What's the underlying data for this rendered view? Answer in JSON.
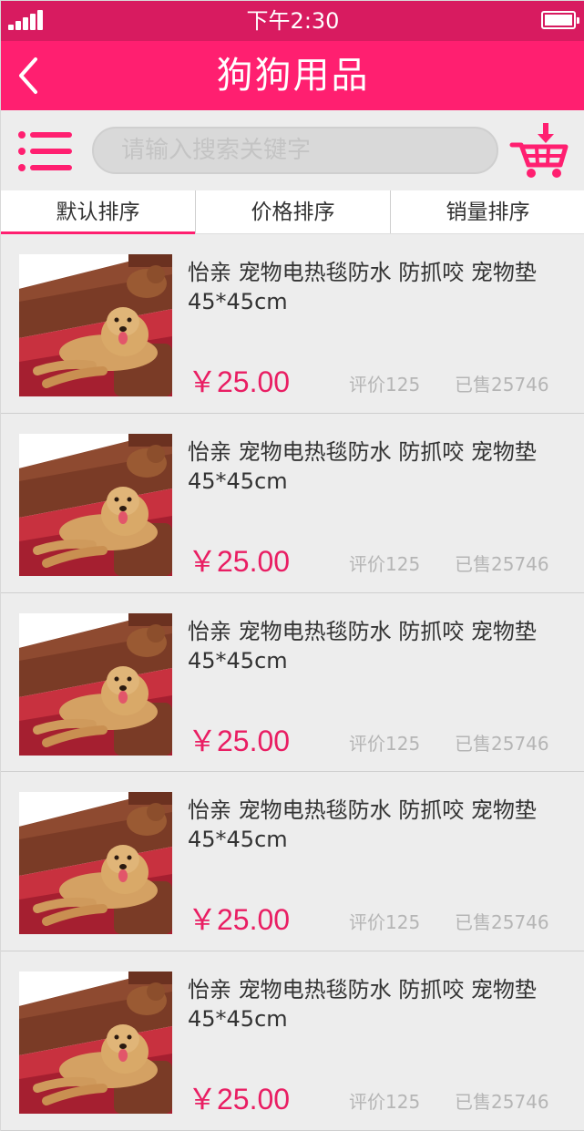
{
  "status_bar": {
    "time": "下午2:30"
  },
  "header": {
    "title": "狗狗用品",
    "back_icon": "chevron-left-icon"
  },
  "search": {
    "placeholder": "请输入搜索关键字",
    "menu_icon": "list-menu-icon",
    "cart_icon": "shopping-cart-icon"
  },
  "sort_tabs": [
    {
      "label": "默认排序",
      "active": true
    },
    {
      "label": "价格排序",
      "active": false
    },
    {
      "label": "销量排序",
      "active": false
    }
  ],
  "products": [
    {
      "title": "怡亲 宠物电热毯防水 防抓咬 宠物垫45*45cm",
      "price": "￥25.00",
      "reviews": "评价125",
      "sold": "已售25746"
    },
    {
      "title": "怡亲 宠物电热毯防水 防抓咬 宠物垫45*45cm",
      "price": "￥25.00",
      "reviews": "评价125",
      "sold": "已售25746"
    },
    {
      "title": "怡亲 宠物电热毯防水 防抓咬 宠物垫45*45cm",
      "price": "￥25.00",
      "reviews": "评价125",
      "sold": "已售25746"
    },
    {
      "title": "怡亲 宠物电热毯防水 防抓咬 宠物垫45*45cm",
      "price": "￥25.00",
      "reviews": "评价125",
      "sold": "已售25746"
    },
    {
      "title": "怡亲 宠物电热毯防水 防抓咬 宠物垫45*45cm",
      "price": "￥25.00",
      "reviews": "评价125",
      "sold": "已售25746"
    }
  ],
  "colors": {
    "status_bar": "#d81b60",
    "header": "#ff1f70",
    "accent": "#e91e63",
    "background": "#ededed"
  }
}
